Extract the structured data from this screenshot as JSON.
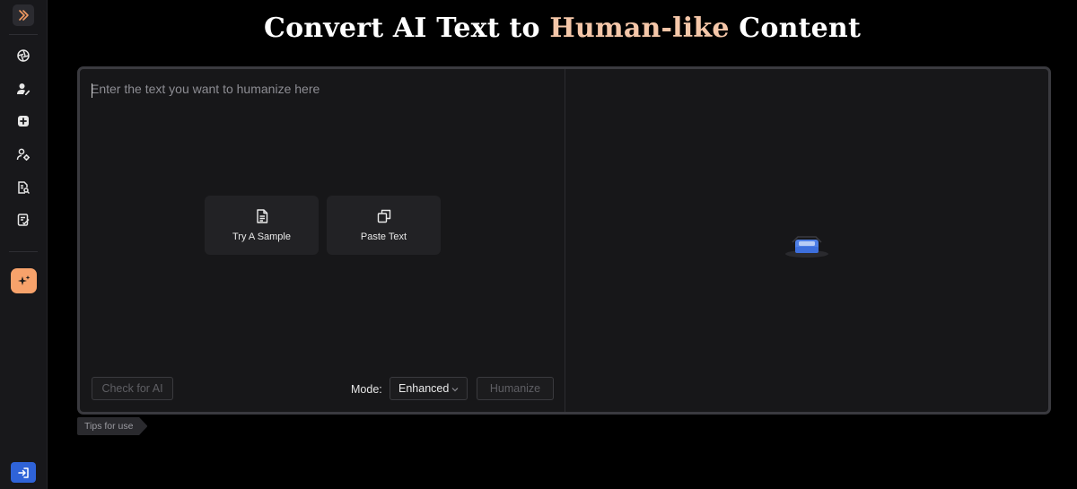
{
  "title": {
    "part1": "Convert AI Text to ",
    "accent": "Human-like",
    "part2": " Content"
  },
  "sidebar": {
    "items": [
      {
        "name": "detector",
        "icon": "aperture-icon"
      },
      {
        "name": "humanizer",
        "icon": "user-edit-icon"
      },
      {
        "name": "add",
        "icon": "plus-square-icon"
      },
      {
        "name": "rewriter",
        "icon": "user-cog-icon"
      },
      {
        "name": "plagiarism",
        "icon": "doc-search-icon"
      },
      {
        "name": "grammar",
        "icon": "doc-check-icon"
      }
    ],
    "accent_color": "#f7a26b",
    "exit_color": "#2f63d8"
  },
  "editor": {
    "placeholder": "Enter the text you want to humanize here",
    "value": ""
  },
  "actions": {
    "sample_label": "Try A Sample",
    "paste_label": "Paste Text"
  },
  "footer": {
    "check_label": "Check for AI",
    "mode_label": "Mode:",
    "mode_value": "Enhanced",
    "humanize_label": "Humanize"
  },
  "tips_label": "Tips for use"
}
